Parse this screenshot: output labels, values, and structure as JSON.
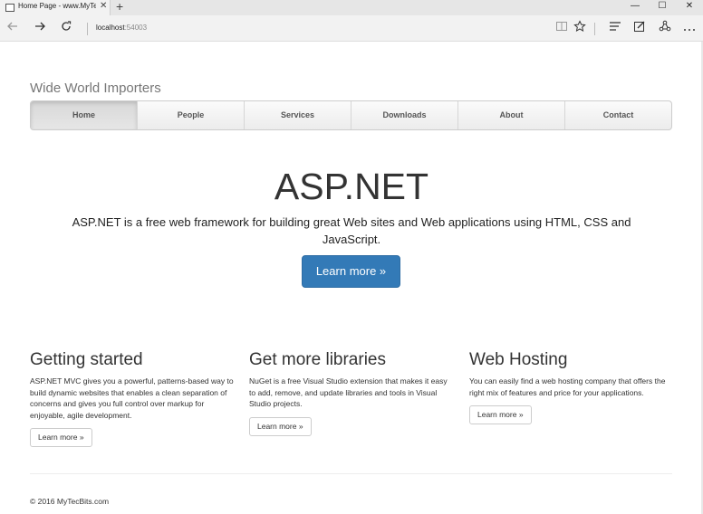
{
  "browser": {
    "tab_title": "Home Page - www.MyTe",
    "tab_close": "✕",
    "new_tab": "+",
    "window_minimize": "—",
    "window_maximize": "☐",
    "window_close": "✕",
    "url_host": "localhost",
    "url_port": ":54003",
    "icons": {
      "back": "back-icon",
      "forward": "forward-icon",
      "refresh": "refresh-icon",
      "reading_view": "reading-view-icon",
      "favorite": "star-icon",
      "hub": "hub-icon",
      "web_note": "web-note-icon",
      "share": "share-icon",
      "more": "more-icon"
    }
  },
  "site": {
    "brand": "Wide World Importers",
    "nav": [
      "Home",
      "People",
      "Services",
      "Downloads",
      "About",
      "Contact"
    ],
    "active_nav": "Home"
  },
  "hero": {
    "title": "ASP.NET",
    "text": "ASP.NET is a free web framework for building great Web sites and Web applications using HTML, CSS and JavaScript.",
    "button": "Learn more »",
    "accent_color": "#337ab7"
  },
  "columns": [
    {
      "title": "Getting started",
      "text": "ASP.NET MVC gives you a powerful, patterns-based way to build dynamic websites that enables a clean separation of concerns and gives you full control over markup for enjoyable, agile development.",
      "button": "Learn more »"
    },
    {
      "title": "Get more libraries",
      "text": "NuGet is a free Visual Studio extension that makes it easy to add, remove, and update libraries and tools in Visual Studio projects.",
      "button": "Learn more »"
    },
    {
      "title": "Web Hosting",
      "text": "You can easily find a web hosting company that offers the right mix of features and price for your applications.",
      "button": "Learn more »"
    }
  ],
  "footer": "© 2016 MyTecBits.com"
}
